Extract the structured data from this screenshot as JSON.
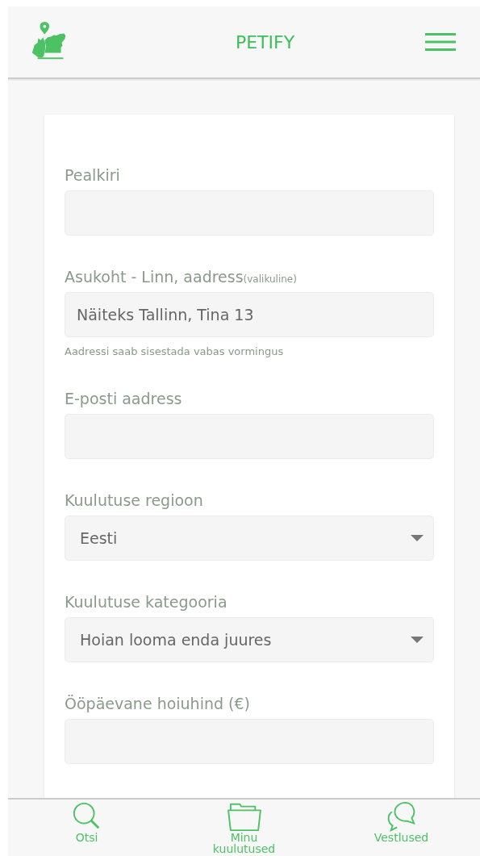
{
  "header": {
    "title": "PETIFY"
  },
  "form": {
    "fields": [
      {
        "kind": "text",
        "label": "Pealkiri"
      },
      {
        "kind": "text",
        "label": "Asukoht - Linn, aadress",
        "optional_note": "(valikuline)",
        "placeholder": "Näiteks Tallinn, Tina 13",
        "hint": "Aadressi saab sisestada vabas vormingus"
      },
      {
        "kind": "text",
        "label": "E-posti aadress"
      },
      {
        "kind": "select",
        "label": "Kuulutuse regioon",
        "value": "Eesti"
      },
      {
        "kind": "select",
        "label": "Kuulutuse kategooria",
        "value": "Hoian looma enda juures"
      },
      {
        "kind": "text",
        "label": "Ööpäevane hoiuhind (€)"
      }
    ]
  },
  "bottom_nav": [
    {
      "kind": "search",
      "label": "Otsi"
    },
    {
      "kind": "folder",
      "label": "Minu kuulutused"
    },
    {
      "kind": "chat",
      "label": "Vestlused"
    }
  ]
}
